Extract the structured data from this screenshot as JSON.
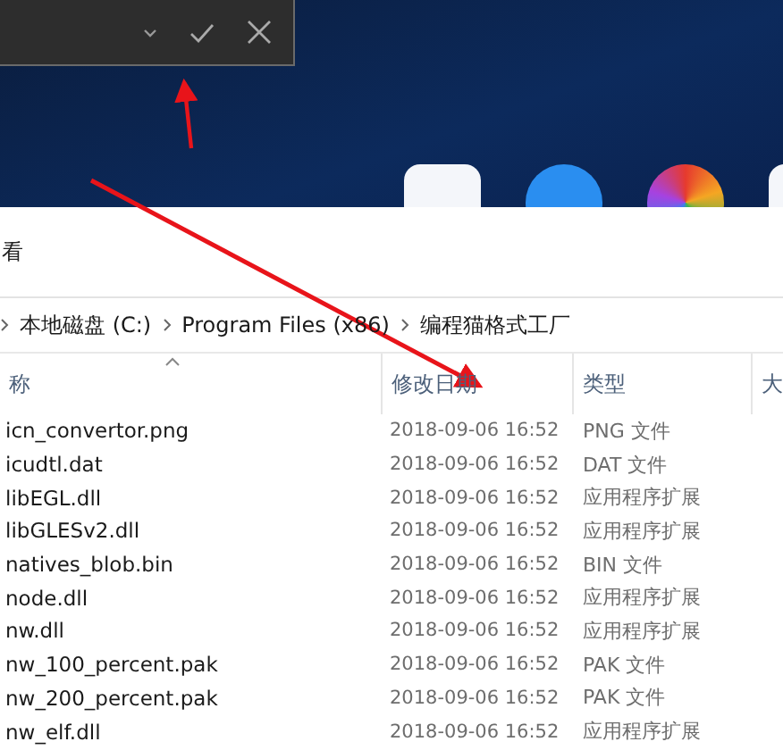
{
  "toolbar": {
    "label": "看"
  },
  "breadcrumb": [
    "本地磁盘 (C:)",
    "Program Files (x86)",
    "编程猫格式工厂"
  ],
  "table": {
    "columns": [
      {
        "label": "称",
        "sorted": true
      },
      {
        "label": "修改日期",
        "sorted": false
      },
      {
        "label": "类型",
        "sorted": false
      },
      {
        "label": "大",
        "sorted": false
      }
    ],
    "rows": [
      {
        "name": "icn_convertor.png",
        "date": "2018-09-06 16:52",
        "type": "PNG 文件"
      },
      {
        "name": "icudtl.dat",
        "date": "2018-09-06 16:52",
        "type": "DAT 文件"
      },
      {
        "name": "libEGL.dll",
        "date": "2018-09-06 16:52",
        "type": "应用程序扩展"
      },
      {
        "name": "libGLESv2.dll",
        "date": "2018-09-06 16:52",
        "type": "应用程序扩展"
      },
      {
        "name": "natives_blob.bin",
        "date": "2018-09-06 16:52",
        "type": "BIN 文件"
      },
      {
        "name": "node.dll",
        "date": "2018-09-06 16:52",
        "type": "应用程序扩展"
      },
      {
        "name": "nw.dll",
        "date": "2018-09-06 16:52",
        "type": "应用程序扩展"
      },
      {
        "name": "nw_100_percent.pak",
        "date": "2018-09-06 16:52",
        "type": "PAK 文件"
      },
      {
        "name": "nw_200_percent.pak",
        "date": "2018-09-06 16:52",
        "type": "PAK 文件"
      },
      {
        "name": "nw_elf.dll",
        "date": "2018-09-06 16:52",
        "type": "应用程序扩展"
      }
    ]
  }
}
